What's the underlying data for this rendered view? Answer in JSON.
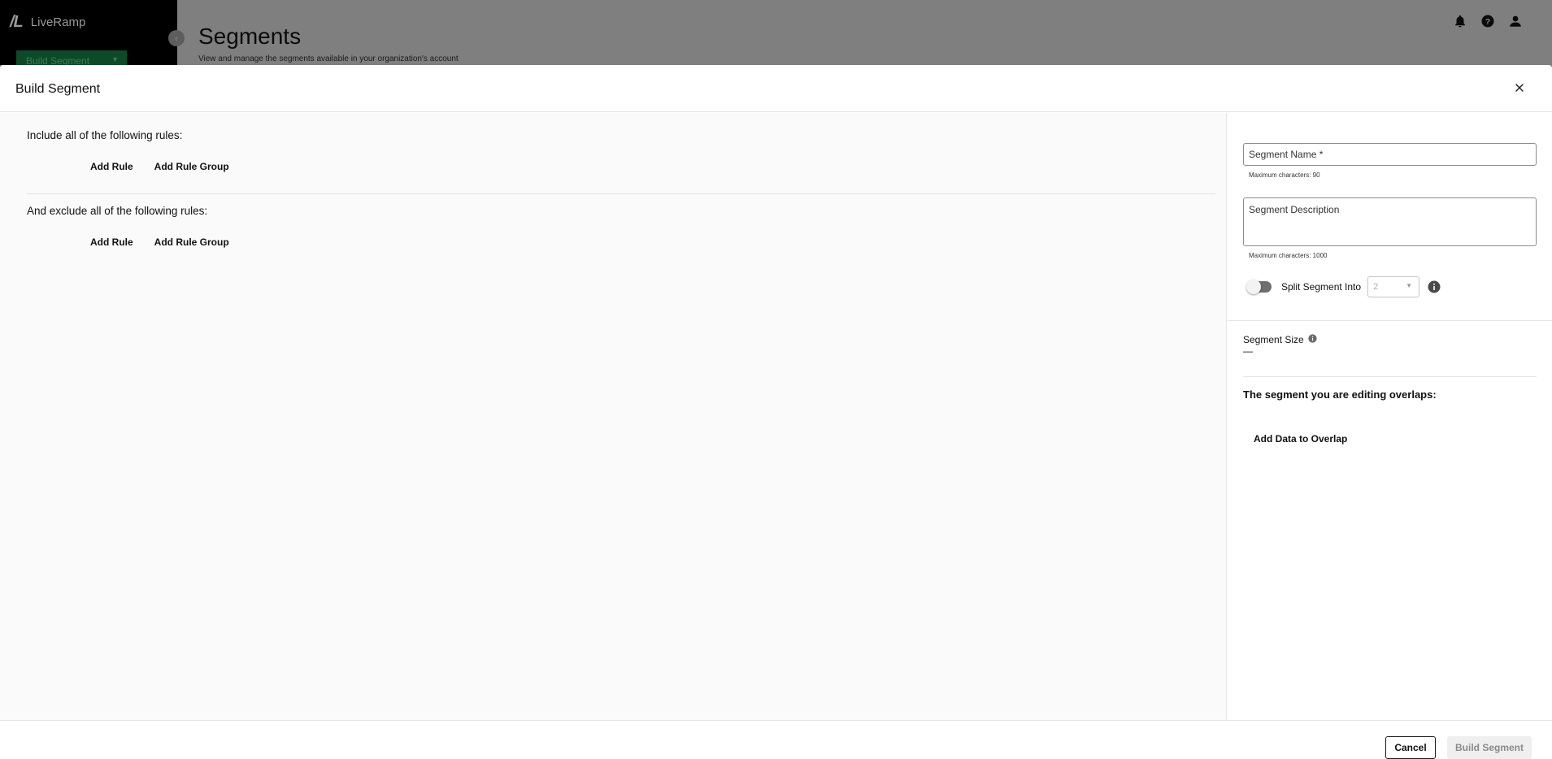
{
  "background": {
    "logo_mark": "/L",
    "logo_name": "LiveRamp",
    "build_button_label": "Build Segment",
    "page_title": "Segments",
    "page_subtitle": "View and manage the segments available in your organization's account",
    "header_icons": [
      "bell-icon",
      "help-icon",
      "user-icon"
    ]
  },
  "modal": {
    "title": "Build Segment",
    "include": {
      "label": "Include all of the following rules:",
      "add_rule": "Add Rule",
      "add_rule_group": "Add Rule Group"
    },
    "exclude": {
      "label": "And exclude all of the following rules:",
      "add_rule": "Add Rule",
      "add_rule_group": "Add Rule Group"
    },
    "details": {
      "name_placeholder": "Segment Name *",
      "name_hint": "Maximum characters: 90",
      "description_placeholder": "Segment Description",
      "description_hint": "Maximum characters: 1000",
      "split_label": "Split Segment Into",
      "split_value": "2",
      "size_label": "Segment Size",
      "size_value": "—",
      "overlap_title": "The segment you are editing overlaps:",
      "overlap_add": "Add Data to Overlap"
    },
    "footer": {
      "cancel": "Cancel",
      "build": "Build Segment"
    }
  },
  "colors": {
    "overlay": "#7f7f7f",
    "sidebar": "#000000",
    "primary_green": "#0d4a2a",
    "disabled_button": "#efefef"
  }
}
